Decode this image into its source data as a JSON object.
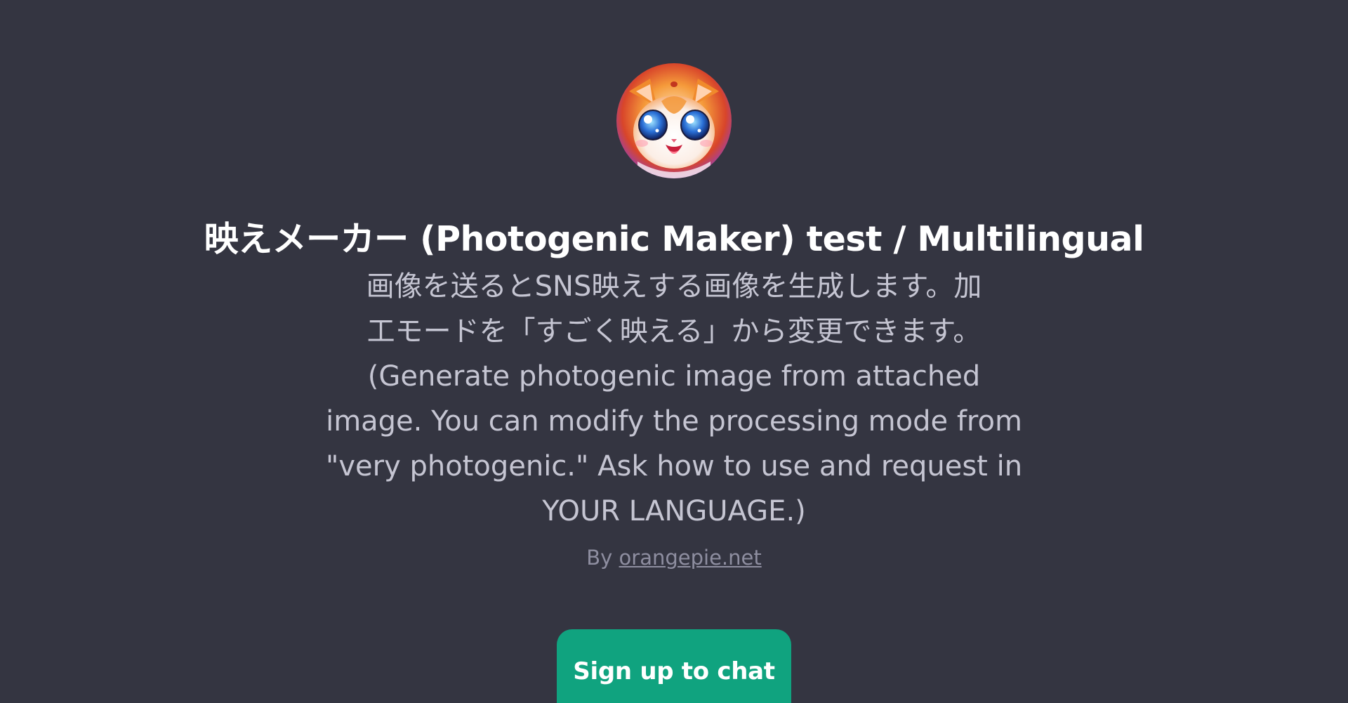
{
  "gpt": {
    "avatar_icon": "cat-avatar-icon",
    "title": "映えメーカー (Photogenic Maker) test / Multilingual",
    "description_lines": [
      "画像を送るとSNS映えする画像を生成します。加",
      "工モードを「すごく映える」から変更できます。",
      "(Generate photogenic image from attached",
      "image. You can modify the processing mode from",
      "\"very photogenic.\" Ask how to use and request in",
      "YOUR LANGUAGE.)"
    ],
    "author_prefix": "By",
    "author_link": "orangepie.net"
  },
  "cta": {
    "signup_label": "Sign up to chat"
  },
  "colors": {
    "background": "#343541",
    "accent": "#10a37f",
    "title": "#ffffff",
    "description": "#c5c5d2",
    "muted": "#8e8ea0"
  }
}
